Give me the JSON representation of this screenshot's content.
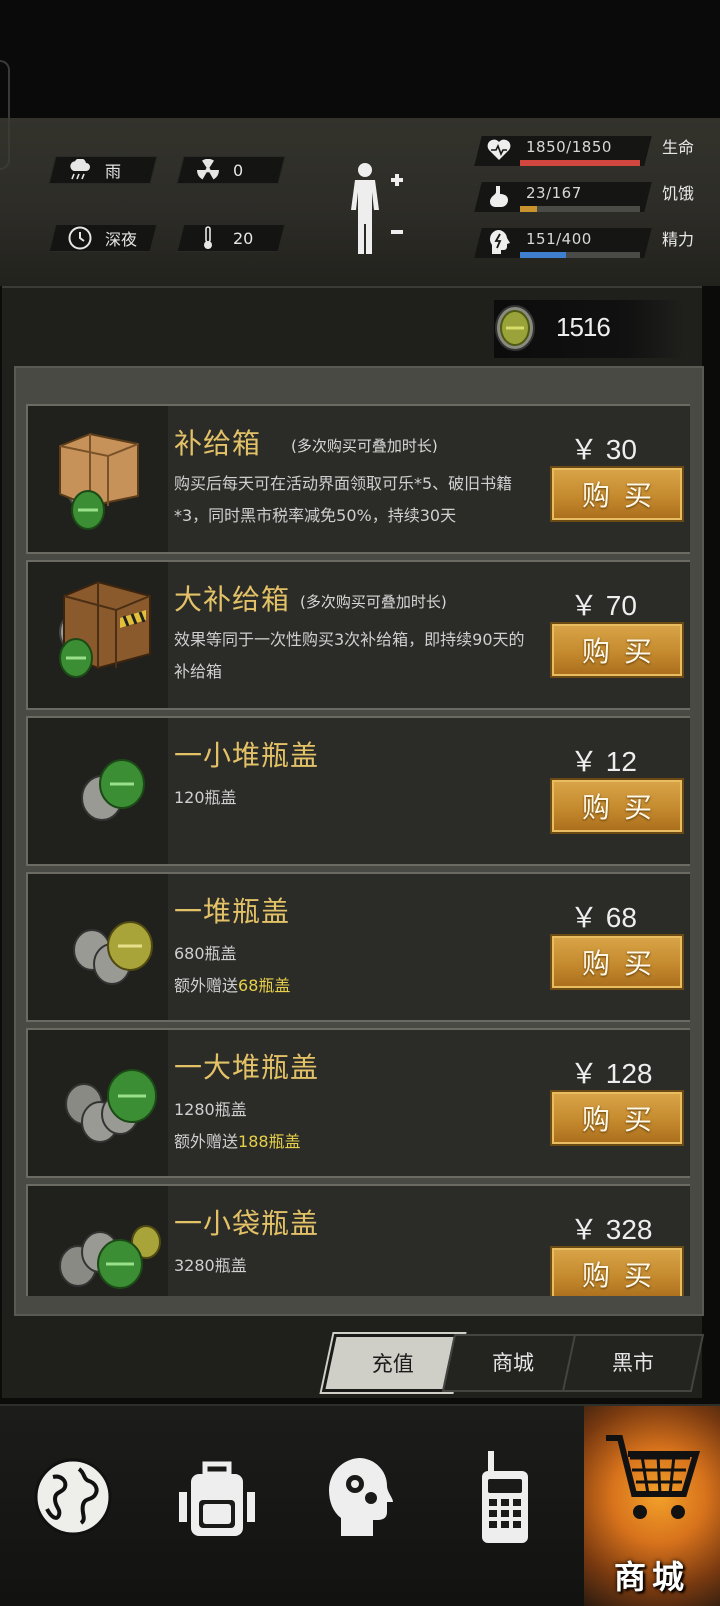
{
  "status": {
    "weather": "雨",
    "radiation": "0",
    "time": "深夜",
    "temperature": "20"
  },
  "vitals": [
    {
      "value": "1850/1850",
      "label": "生命",
      "level": 1.0,
      "color": "#d1463e",
      "icon": "heart-icon"
    },
    {
      "value": "23/167",
      "label": "饥饿",
      "level": 0.14,
      "color": "#c8922e",
      "icon": "stomach-icon"
    },
    {
      "value": "151/400",
      "label": "精力",
      "level": 0.38,
      "color": "#3f7fd0",
      "icon": "brain-energy-icon"
    }
  ],
  "currency": {
    "amount": "1516",
    "icon": "bottle-cap-icon"
  },
  "products": [
    {
      "title": "补给箱",
      "note": "(多次购买可叠加时长)",
      "desc": "购买后每天可在活动界面领取可乐*5、破旧书籍*3，同时黑市税率减免50%，持续30天",
      "desc_extra_prefix": "",
      "desc_extra_highlight": "",
      "price": "￥ 30",
      "buy": "购买",
      "image": "supply-box-image"
    },
    {
      "title": "大补给箱",
      "note": "(多次购买可叠加时长)",
      "desc": "效果等同于一次性购买3次补给箱，即持续90天的补给箱",
      "desc_extra_prefix": "",
      "desc_extra_highlight": "",
      "price": "￥ 70",
      "buy": "购买",
      "image": "big-supply-box-image"
    },
    {
      "title": "一小堆瓶盖",
      "note": "",
      "desc": "120瓶盖",
      "desc_extra_prefix": "",
      "desc_extra_highlight": "",
      "price": "￥ 12",
      "buy": "购买",
      "image": "small-cap-pile-image"
    },
    {
      "title": "一堆瓶盖",
      "note": "",
      "desc": "680瓶盖",
      "desc_extra_prefix": "额外赠送",
      "desc_extra_highlight": "68瓶盖",
      "price": "￥ 68",
      "buy": "购买",
      "image": "cap-pile-image"
    },
    {
      "title": "一大堆瓶盖",
      "note": "",
      "desc": "1280瓶盖",
      "desc_extra_prefix": "额外赠送",
      "desc_extra_highlight": "188瓶盖",
      "price": "￥ 128",
      "buy": "购买",
      "image": "big-cap-pile-image"
    },
    {
      "title": "一小袋瓶盖",
      "note": "",
      "desc": "3280瓶盖",
      "desc_extra_prefix": "",
      "desc_extra_highlight": "",
      "price": "￥ 328",
      "buy": "购买",
      "image": "cap-bag-image"
    }
  ],
  "tabs": [
    {
      "label": "充值",
      "active": true
    },
    {
      "label": "商城",
      "active": false
    },
    {
      "label": "黑市",
      "active": false
    }
  ],
  "bottom_nav": [
    {
      "name": "globe-icon"
    },
    {
      "name": "backpack-icon"
    },
    {
      "name": "skills-head-icon"
    },
    {
      "name": "radio-icon"
    },
    {
      "name": "shop-cart-icon",
      "label": "商城"
    }
  ]
}
